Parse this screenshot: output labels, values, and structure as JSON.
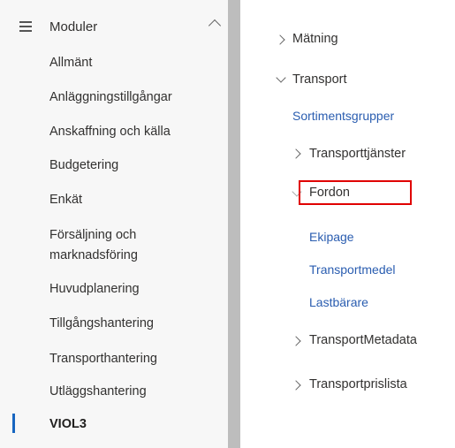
{
  "left_nav": {
    "header": {
      "label": "Moduler",
      "icon": "modules-list-icon",
      "chevron": "chevron-up-icon"
    },
    "items": [
      {
        "label": "Allmänt"
      },
      {
        "label": "Anläggningstillgångar"
      },
      {
        "label": "Anskaffning och källa"
      },
      {
        "label": "Budgetering"
      },
      {
        "label": "Enkät"
      },
      {
        "label_line1": "Försäljning och",
        "label_line2": "marknadsföring"
      },
      {
        "label": "Huvudplanering"
      },
      {
        "label": "Tillgångshantering"
      },
      {
        "label": "Transporthantering"
      },
      {
        "label": "Utläggshantering"
      },
      {
        "label": "VIOL3",
        "active": true
      }
    ],
    "active_indicator_color": "#1765c0"
  },
  "tree": {
    "matning": "Mätning",
    "transport": "Transport",
    "sortimentsgrupper": "Sortimentsgrupper",
    "transporttjanster": "Transporttjänster",
    "fordon": "Fordon",
    "ekipage": "Ekipage",
    "transportmedel": "Transportmedel",
    "lastbarare": "Lastbärare",
    "transport_metadata": "TransportMetadata",
    "transportprislista": "Transportprislista"
  },
  "colors": {
    "link": "#2a5db0",
    "highlight": "#e00000",
    "splitter": "#bdbdbd",
    "nav_bg": "#f7f7f7"
  }
}
